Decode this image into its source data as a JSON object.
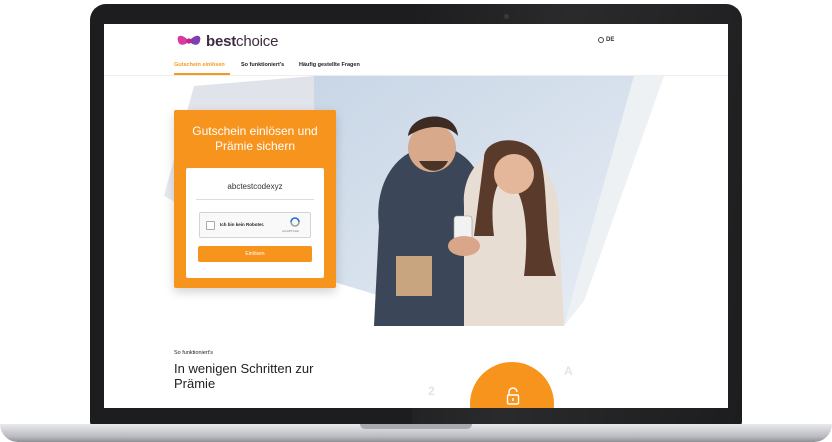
{
  "logo": {
    "bold": "best",
    "thin": "choice"
  },
  "lang": "DE",
  "nav": [
    {
      "label": "Gutschein einlösen",
      "active": true
    },
    {
      "label": "So funktioniert's",
      "active": false
    },
    {
      "label": "Häufig gestellte Fragen",
      "active": false
    }
  ],
  "card": {
    "title": "Gutschein einlösen und Prämie sichern",
    "code": "abctestcodexyz",
    "captcha_label": "Ich bin kein Roboter.",
    "captcha_brand": "reCAPTCHA",
    "submit": "Einlösen"
  },
  "section": {
    "label": "So funktioniert's",
    "title": "In wenigen Schritten zur Prämie"
  },
  "steps": {
    "number": "2",
    "letter": "A"
  },
  "colors": {
    "accent": "#f7941d",
    "brand_dark": "#3c2c3e"
  },
  "icons": {
    "captcha": "recaptcha-icon",
    "lang": "globe-icon",
    "step": "lock-icon"
  }
}
